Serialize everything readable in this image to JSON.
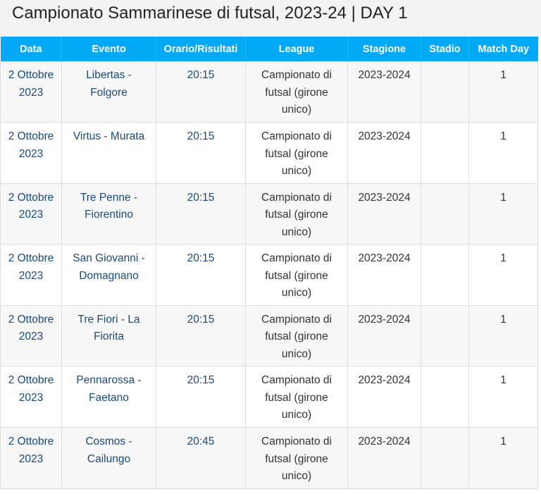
{
  "page_title": "Campionato Sammarinese di futsal, 2023-24 | DAY 1",
  "table": {
    "headers": {
      "date": "Data",
      "event": "Evento",
      "time": "Orario/Risultati",
      "league": "League",
      "season": "Stagione",
      "stadium": "Stadio",
      "matchday": "Match Day"
    },
    "rows": [
      {
        "date": "2 Ottobre 2023",
        "event": "Libertas - Folgore",
        "time": "20:15",
        "league": "Campionato di futsal (girone unico)",
        "season": "2023-2024",
        "stadium": "",
        "matchday": "1"
      },
      {
        "date": "2 Ottobre 2023",
        "event": "Virtus - Murata",
        "time": "20:15",
        "league": "Campionato di futsal (girone unico)",
        "season": "2023-2024",
        "stadium": "",
        "matchday": "1"
      },
      {
        "date": "2 Ottobre 2023",
        "event": "Tre Penne - Fiorentino",
        "time": "20:15",
        "league": "Campionato di futsal (girone unico)",
        "season": "2023-2024",
        "stadium": "",
        "matchday": "1"
      },
      {
        "date": "2 Ottobre 2023",
        "event": "San Giovanni - Domagnano",
        "time": "20:15",
        "league": "Campionato di futsal (girone unico)",
        "season": "2023-2024",
        "stadium": "",
        "matchday": "1"
      },
      {
        "date": "2 Ottobre 2023",
        "event": "Tre Fiori - La Fiorita",
        "time": "20:15",
        "league": "Campionato di futsal (girone unico)",
        "season": "2023-2024",
        "stadium": "",
        "matchday": "1"
      },
      {
        "date": "2 Ottobre 2023",
        "event": "Pennarossa - Faetano",
        "time": "20:15",
        "league": "Campionato di futsal (girone unico)",
        "season": "2023-2024",
        "stadium": "",
        "matchday": "1"
      },
      {
        "date": "2 Ottobre 2023",
        "event": "Cosmos - Cailungo",
        "time": "20:45",
        "league": "Campionato di futsal (girone unico)",
        "season": "2023-2024",
        "stadium": "",
        "matchday": "1"
      }
    ]
  },
  "colors": {
    "header_bg": "#03a9f4",
    "link": "#1a4a7a",
    "row_alt": "#f7f7f7"
  }
}
